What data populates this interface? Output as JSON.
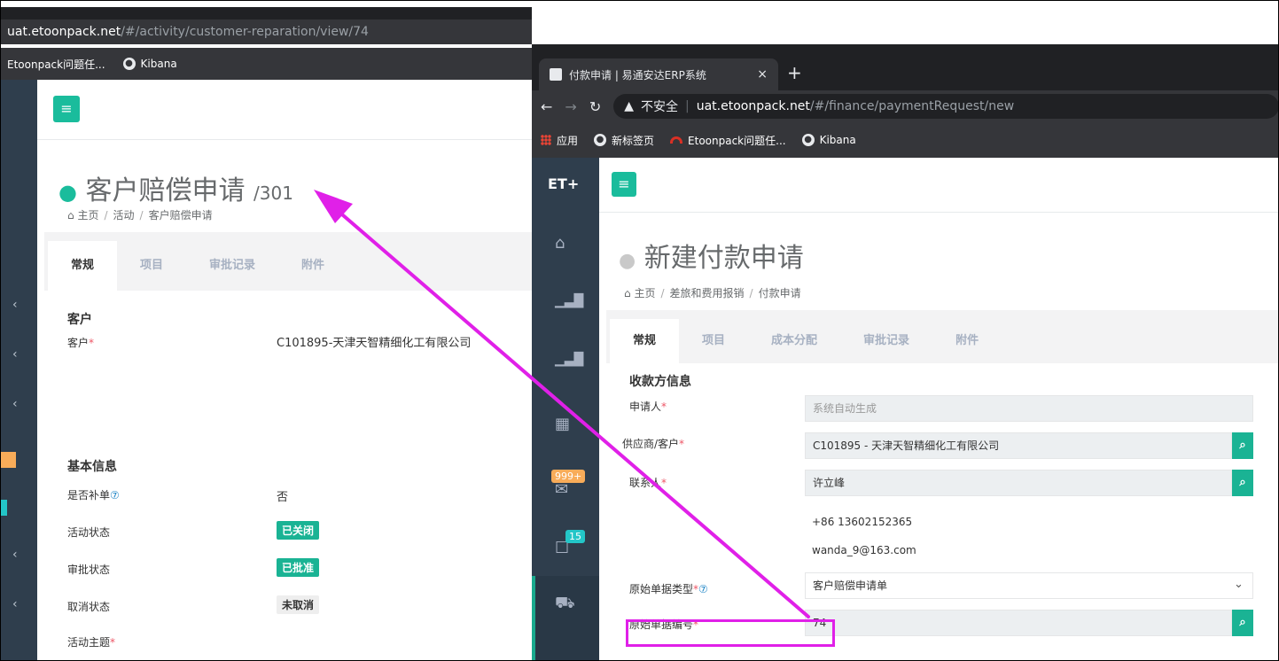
{
  "left_window": {
    "url_domain": "uat.etoonpack.net",
    "url_path": "/#/activity/customer-reparation/view/74",
    "bookmarks": [
      "Etoonpack问题任...",
      "Kibana"
    ],
    "title": "客户赔偿申请",
    "title_suffix": "/301",
    "breadcrumb": [
      "主页",
      "活动",
      "客户赔偿申请"
    ],
    "tabs": [
      "常规",
      "项目",
      "审批记录",
      "附件"
    ],
    "section_customer": "客户",
    "customer_label": "客户",
    "customer_value": "C101895-天津天智精细化工有限公司",
    "section_basic": "基本信息",
    "fields": [
      {
        "label": "是否补单",
        "value": "否"
      },
      {
        "label": "活动状态",
        "value": "已关闭"
      },
      {
        "label": "审批状态",
        "value": "已批准"
      },
      {
        "label": "取消状态",
        "value": "未取消"
      },
      {
        "label": "活动主题",
        "value": ""
      }
    ]
  },
  "right_window": {
    "tab_title": "付款申请 | 易通安达ERP系统",
    "tab_close": "×",
    "new_tab": "+",
    "insecure_label": "不安全",
    "url_domain": "uat.etoonpack.net",
    "url_path": "/#/finance/paymentRequest/new",
    "bookmarks": [
      "应用",
      "新标签页",
      "Etoonpack问题任...",
      "Kibana"
    ],
    "logo": "ET+",
    "badge_mail": "999+",
    "badge_tasks": "15",
    "title": "新建付款申请",
    "breadcrumb": [
      "主页",
      "差旅和费用报销",
      "付款申请"
    ],
    "tabs": [
      "常规",
      "项目",
      "成本分配",
      "审批记录",
      "附件"
    ],
    "section": "收款方信息",
    "applicant_label": "申请人",
    "applicant_placeholder": "系统自动生成",
    "supplier_label": "供应商/客户",
    "supplier_value": "C101895 - 天津天智精细化工有限公司",
    "contact_label": "联系人",
    "contact_value": "许立峰",
    "phone": "+86 13602152365",
    "email": "wanda_9@163.com",
    "doc_type_label": "原始单据类型",
    "doc_type_value": "客户赔偿申请单",
    "doc_no_label": "原始单据编号",
    "doc_no_value": "74"
  },
  "colors": {
    "accent": "#1ab394",
    "annotation": "#e020e8",
    "sidebar": "#2f3e4d",
    "required": "#ed5565"
  }
}
